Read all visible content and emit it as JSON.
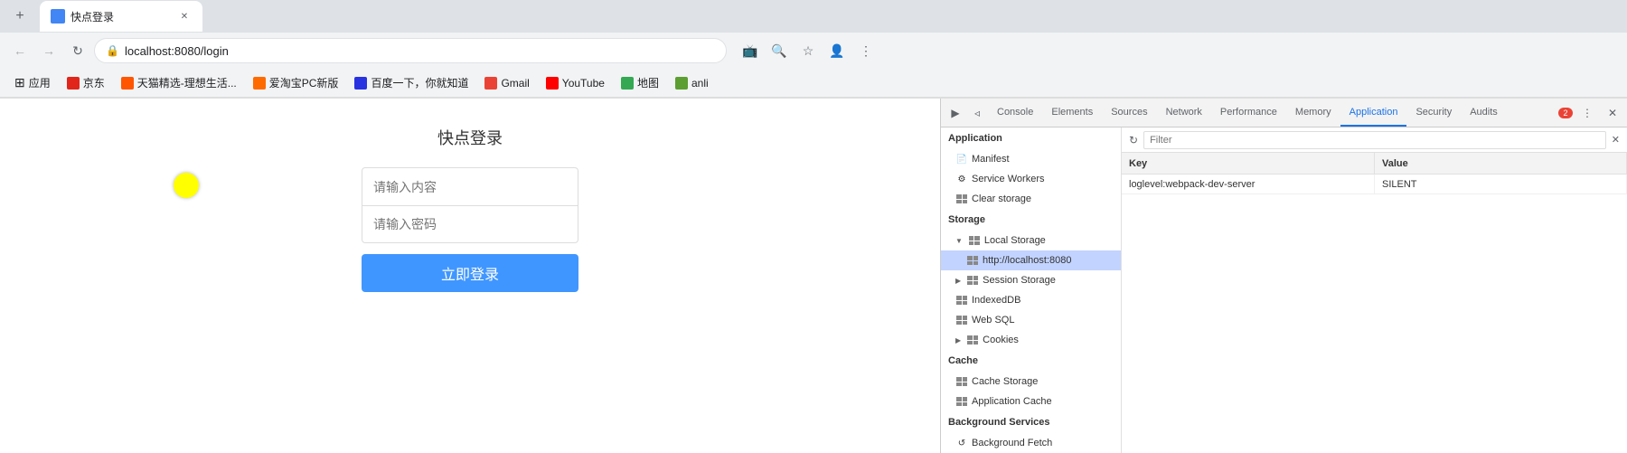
{
  "browser": {
    "url": "localhost:8080/login",
    "tab_title": "快点登录",
    "back_disabled": true,
    "forward_disabled": true
  },
  "bookmarks": [
    {
      "id": "apps",
      "label": "应用",
      "icon": "apps"
    },
    {
      "id": "jd",
      "label": "京东",
      "color": "#e1251b"
    },
    {
      "id": "tianmao",
      "label": "天猫精选-理想生活...",
      "color": "#ff5500"
    },
    {
      "id": "aitaobao",
      "label": "爱淘宝PC新版",
      "color": "#ff6a00"
    },
    {
      "id": "baidu",
      "label": "百度一下，你就知道",
      "color": "#2932e1"
    },
    {
      "id": "gmail",
      "label": "Gmail",
      "color": "#ea4335"
    },
    {
      "id": "youtube",
      "label": "YouTube",
      "color": "#ff0000"
    },
    {
      "id": "maps",
      "label": "地图",
      "color": "#34a853"
    },
    {
      "id": "anli",
      "label": "anli",
      "color": "#5c9e31"
    }
  ],
  "page": {
    "login_title": "快点登录",
    "username_placeholder": "请输入内容",
    "password_placeholder": "请输入密码",
    "login_button": "立即登录"
  },
  "devtools": {
    "tabs": [
      {
        "id": "console",
        "label": "Console",
        "active": false
      },
      {
        "id": "elements",
        "label": "Elements",
        "active": false
      },
      {
        "id": "sources",
        "label": "Sources",
        "active": false
      },
      {
        "id": "network",
        "label": "Network",
        "active": false
      },
      {
        "id": "performance",
        "label": "Performance",
        "active": false
      },
      {
        "id": "memory",
        "label": "Memory",
        "active": false
      },
      {
        "id": "application",
        "label": "Application",
        "active": true
      },
      {
        "id": "security",
        "label": "Security",
        "active": false
      },
      {
        "id": "audits",
        "label": "Audits",
        "active": false
      }
    ],
    "error_count": "2",
    "filter_placeholder": "Filter",
    "sidebar": {
      "sections": [
        {
          "id": "application-section",
          "label": "Application",
          "items": [
            {
              "id": "manifest",
              "label": "Manifest",
              "icon": "manifest",
              "indent": 1
            },
            {
              "id": "service-workers",
              "label": "Service Workers",
              "icon": "gear",
              "indent": 1
            },
            {
              "id": "clear-storage",
              "label": "Clear storage",
              "icon": "storage",
              "indent": 1
            }
          ]
        },
        {
          "id": "storage-section",
          "label": "Storage",
          "items": [
            {
              "id": "local-storage",
              "label": "Local Storage",
              "icon": "storage",
              "indent": 1,
              "expanded": true
            },
            {
              "id": "local-storage-host",
              "label": "http://localhost:8080",
              "icon": "storage",
              "indent": 2,
              "selected": true
            },
            {
              "id": "session-storage",
              "label": "Session Storage",
              "icon": "storage",
              "indent": 1,
              "expanded": false
            },
            {
              "id": "indexeddb",
              "label": "IndexedDB",
              "icon": "storage",
              "indent": 1
            },
            {
              "id": "web-sql",
              "label": "Web SQL",
              "icon": "storage",
              "indent": 1
            },
            {
              "id": "cookies",
              "label": "Cookies",
              "icon": "storage",
              "indent": 1,
              "expandable": true
            }
          ]
        },
        {
          "id": "cache-section",
          "label": "Cache",
          "items": [
            {
              "id": "cache-storage",
              "label": "Cache Storage",
              "icon": "storage",
              "indent": 1
            },
            {
              "id": "application-cache",
              "label": "Application Cache",
              "icon": "storage",
              "indent": 1
            }
          ]
        },
        {
          "id": "background-services-section",
          "label": "Background Services",
          "items": [
            {
              "id": "background-fetch",
              "label": "Background Fetch",
              "icon": "gear",
              "indent": 1
            }
          ]
        }
      ]
    },
    "table": {
      "columns": [
        "Key",
        "Value"
      ],
      "rows": [
        {
          "key": "loglevel:webpack-dev-server",
          "value": "SILENT"
        }
      ]
    }
  }
}
